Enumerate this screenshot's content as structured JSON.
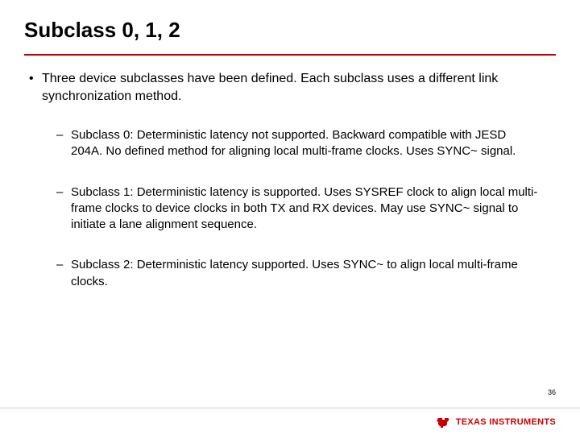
{
  "title": "Subclass 0, 1, 2",
  "intro": "Three device subclasses have been defined. Each subclass uses a different link synchronization method.",
  "sub_items": [
    "Subclass 0: Deterministic latency not supported. Backward compatible with JESD 204A. No defined method for aligning local multi-frame clocks. Uses SYNC~ signal.",
    "Subclass 1: Deterministic latency is supported. Uses SYSREF clock to align local multi-frame clocks to device clocks in both TX and RX devices. May use SYNC~ signal to initiate a lane alignment sequence.",
    "Subclass 2: Deterministic latency supported. Uses SYNC~ to align local multi-frame clocks."
  ],
  "page_number": "36",
  "footer": {
    "brand": "TEXAS INSTRUMENTS"
  }
}
